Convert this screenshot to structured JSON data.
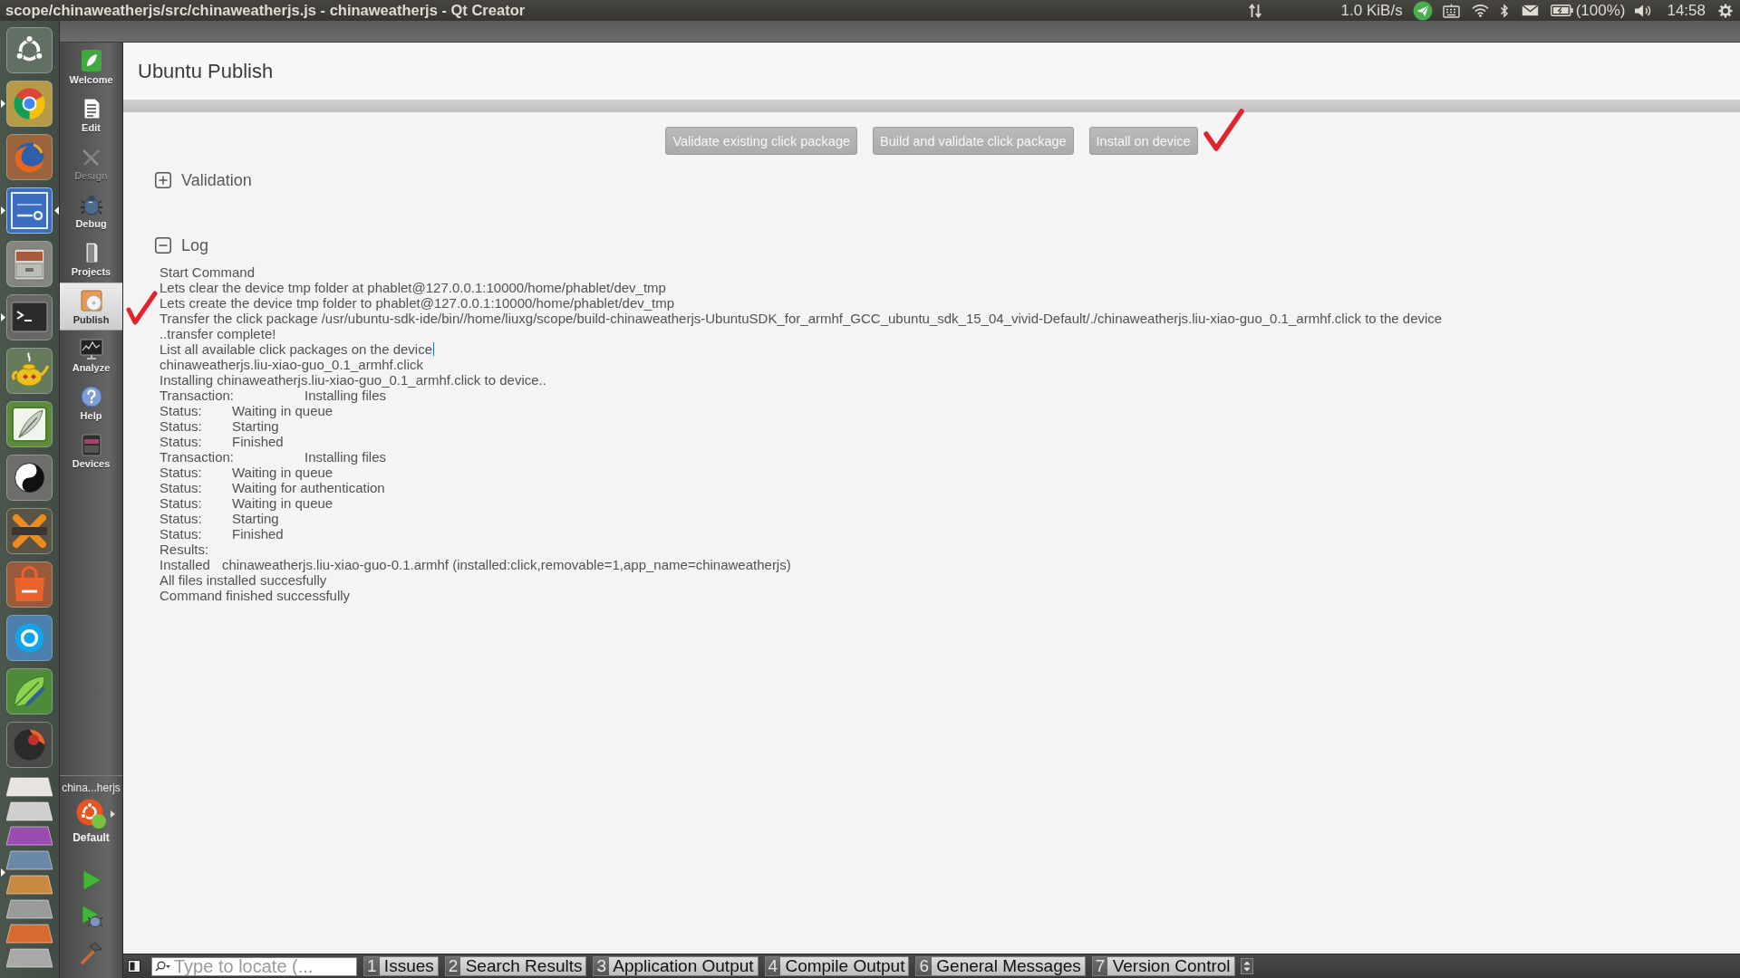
{
  "top_panel": {
    "title": "scope/chinaweatherjs/src/chinaweatherjs.js - chinaweatherjs - Qt Creator",
    "network_speed": "1.0 KiB/s",
    "battery": "(100%)",
    "clock": "14:58"
  },
  "launcher": [
    {
      "kind": "dash",
      "running": false,
      "focused": false
    },
    {
      "kind": "browser",
      "running": true,
      "focused": false
    },
    {
      "kind": "fox",
      "running": false,
      "focused": false
    },
    {
      "kind": "sdk",
      "running": true,
      "focused": true
    },
    {
      "kind": "cabinet",
      "running": false,
      "focused": false
    },
    {
      "kind": "terminal",
      "running": true,
      "focused": false
    },
    {
      "kind": "teapot",
      "running": false,
      "focused": false
    },
    {
      "kind": "feather",
      "running": false,
      "focused": false
    },
    {
      "kind": "yinyang",
      "running": false,
      "focused": false
    },
    {
      "kind": "chat",
      "running": false,
      "focused": false
    },
    {
      "kind": "store",
      "running": false,
      "focused": false
    },
    {
      "kind": "bubble",
      "running": false,
      "focused": false
    },
    {
      "kind": "leaf",
      "running": false,
      "focused": false
    },
    {
      "kind": "orb",
      "running": false,
      "focused": false
    },
    {
      "kind": "stack",
      "running": true,
      "focused": false
    }
  ],
  "mode_bar": {
    "modes": [
      {
        "kind": "welcome",
        "label": "Welcome",
        "selected": false,
        "disabled": false
      },
      {
        "kind": "edit",
        "label": "Edit",
        "selected": false,
        "disabled": false
      },
      {
        "kind": "design",
        "label": "Design",
        "selected": false,
        "disabled": true
      },
      {
        "kind": "debug",
        "label": "Debug",
        "selected": false,
        "disabled": false
      },
      {
        "kind": "projects",
        "label": "Projects",
        "selected": false,
        "disabled": false
      },
      {
        "kind": "publish",
        "label": "Publish",
        "selected": true,
        "disabled": false
      },
      {
        "kind": "analyze",
        "label": "Analyze",
        "selected": false,
        "disabled": false
      },
      {
        "kind": "help",
        "label": "Help",
        "selected": false,
        "disabled": false
      },
      {
        "kind": "devices",
        "label": "Devices",
        "selected": false,
        "disabled": false
      }
    ],
    "project": "china...herjs",
    "kit": "Default"
  },
  "page": {
    "title": "Ubuntu Publish",
    "buttons": [
      "Validate existing click package",
      "Build and validate click package",
      "Install on device"
    ],
    "sections": [
      {
        "title": "Validation",
        "expanded": false
      },
      {
        "title": "Log",
        "expanded": true,
        "lines": [
          {
            "kind": "text",
            "text": "Start Command",
            "caret": false
          },
          {
            "kind": "text",
            "text": "Lets clear the device tmp folder at phablet@127.0.0.1:10000/home/phablet/dev_tmp",
            "caret": false
          },
          {
            "kind": "text",
            "text": "Lets create the device tmp folder to phablet@127.0.0.1:10000/home/phablet/dev_tmp",
            "caret": false
          },
          {
            "kind": "text",
            "text": "Transfer the click package /usr/ubuntu-sdk-ide/bin//home/liuxg/scope/build-chinaweatherjs-UbuntuSDK_for_armhf_GCC_ubuntu_sdk_15_04_vivid-Default/./chinaweatherjs.liu-xiao-guo_0.1_armhf.click to the device",
            "caret": false
          },
          {
            "kind": "text",
            "text": "..transfer complete!",
            "caret": false
          },
          {
            "kind": "text",
            "text": "List all available click packages on the device",
            "caret": true
          },
          {
            "kind": "text",
            "text": "chinaweatherjs.liu-xiao-guo_0.1_armhf.click",
            "caret": false
          },
          {
            "kind": "text",
            "text": "Installing chinaweatherjs.liu-xiao-guo_0.1_armhf.click to device..",
            "caret": false
          },
          {
            "kind": "tabbed",
            "label": "Transaction:",
            "value": "Installing files",
            "caret": false
          },
          {
            "kind": "tabbed",
            "label": "Status:",
            "value": "Waiting in queue",
            "caret": false
          },
          {
            "kind": "tabbed",
            "label": "Status:",
            "value": "Starting",
            "caret": false
          },
          {
            "kind": "tabbed",
            "label": "Status:",
            "value": "Finished",
            "caret": false
          },
          {
            "kind": "tabbed",
            "label": "Transaction:",
            "value": "Installing files",
            "caret": false
          },
          {
            "kind": "tabbed",
            "label": "Status:",
            "value": "Waiting in queue",
            "caret": false
          },
          {
            "kind": "tabbed",
            "label": "Status:",
            "value": "Waiting for authentication",
            "caret": false
          },
          {
            "kind": "tabbed",
            "label": "Status:",
            "value": "Waiting in queue",
            "caret": false
          },
          {
            "kind": "tabbed",
            "label": "Status:",
            "value": "Starting",
            "caret": false
          },
          {
            "kind": "tabbed",
            "label": "Status:",
            "value": "Finished",
            "caret": false
          },
          {
            "kind": "text",
            "text": "Results:",
            "caret": false
          },
          {
            "kind": "spaced",
            "label": "Installed",
            "value": "chinaweatherjs.liu-xiao-guo-0.1.armhf (installed:click,removable=1,app_name=chinaweatherjs)",
            "caret": false
          },
          {
            "kind": "text",
            "text": "All files installed succesfully",
            "caret": false
          },
          {
            "kind": "text",
            "text": "Command finished successfully",
            "caret": false
          }
        ]
      }
    ]
  },
  "output_bar": {
    "locator_placeholder": "Type to locate (...",
    "panes": [
      {
        "number": "1",
        "label": "Issues"
      },
      {
        "number": "2",
        "label": "Search Results"
      },
      {
        "number": "3",
        "label": "Application Output"
      },
      {
        "number": "4",
        "label": "Compile Output"
      },
      {
        "number": "6",
        "label": "General Messages"
      },
      {
        "number": "7",
        "label": "Version Control"
      }
    ]
  }
}
